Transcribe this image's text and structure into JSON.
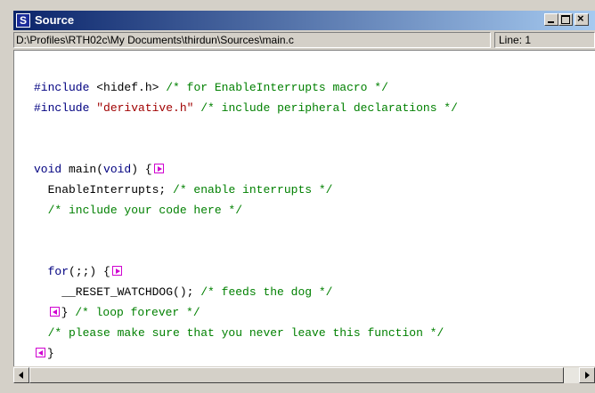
{
  "window": {
    "title": "Source",
    "icon_letter": "S",
    "icon": "source-window-icon",
    "controls": [
      "minimize-icon",
      "maximize-icon",
      "close-icon"
    ]
  },
  "status": {
    "path": "D:\\Profiles\\RTH02c\\My Documents\\thirdun\\Sources\\main.c",
    "line": "Line: 1"
  },
  "code": {
    "line1_kw": "#include",
    "line1_plain": " <hidef.h> ",
    "line1_comment": "/* for EnableInterrupts macro */",
    "line2_kw": "#include",
    "line2_str": " \"derivative.h\"",
    "line2_comment": " /* include peripheral declarations */",
    "line5_kw1": "void",
    "line5_plain1": " main(",
    "line5_kw2": "void",
    "line5_plain2": ") {",
    "line6_plain": "  EnableInterrupts; ",
    "line6_comment": "/* enable interrupts */",
    "line7_comment": "  /* include your code here */",
    "line10_kw": "  for",
    "line10_plain": "(;;) {",
    "line11_plain": "    __RESET_WATCHDOG(); ",
    "line11_comment": "/* feeds the dog */",
    "line12_plain": "} ",
    "line12_comment": "/* loop forever */",
    "line13_comment": "  /* please make sure that you never leave this function */",
    "line14_plain": "}"
  },
  "colors": {
    "title_bar_start": "#0a246a",
    "keyword": "#000080",
    "comment": "#008000",
    "string": "#a00000",
    "fold_marker": "#d000d0"
  }
}
